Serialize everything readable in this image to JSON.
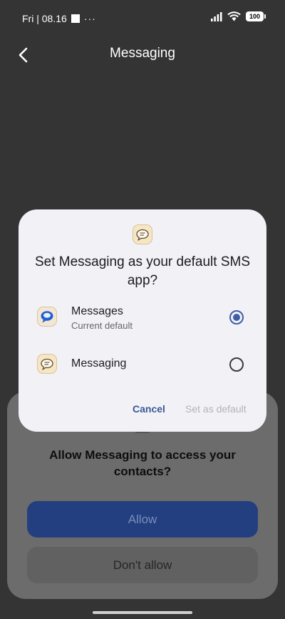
{
  "status_bar": {
    "time": "Fri | 08.16",
    "dots": "···",
    "battery": "100"
  },
  "header": {
    "title": "Messaging"
  },
  "dialog": {
    "title": "Set Messaging as your default SMS app?",
    "options": [
      {
        "name": "Messages",
        "subtitle": "Current default",
        "selected": true
      },
      {
        "name": "Messaging",
        "subtitle": "",
        "selected": false
      }
    ],
    "cancel_label": "Cancel",
    "confirm_label": "Set as default"
  },
  "permission_sheet": {
    "title": "Allow Messaging to access your contacts?",
    "allow_label": "Allow",
    "deny_label": "Don't allow"
  },
  "colors": {
    "accent": "#3e5ea6",
    "allow_button": "#243f7f",
    "dialog_bg": "#f2f1f6",
    "scrim_bg": "#343434"
  }
}
